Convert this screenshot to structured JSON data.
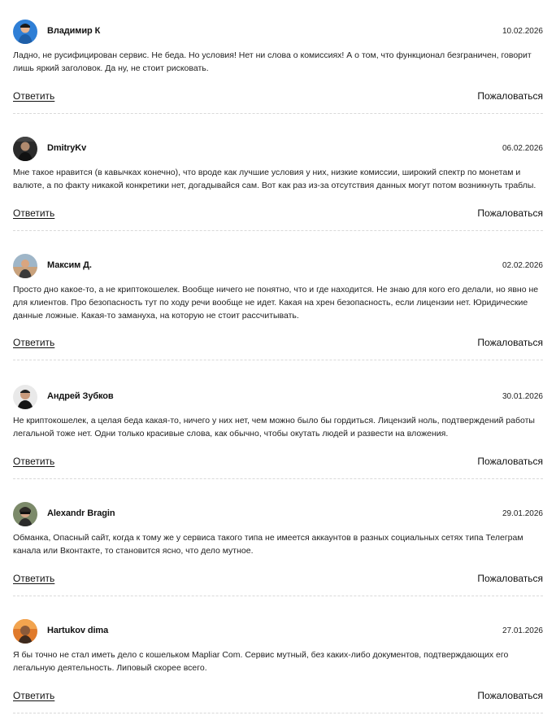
{
  "comments": [
    {
      "author": "Владимир К",
      "date": "10.02.2026",
      "text": "Ладно, не русифицирован сервис. Не беда. Но условия! Нет ни слова о комиссиях! А о том, что функционал безграничен, говорит лишь яркий заголовок. Да ну, не стоит рисковать.",
      "reply": "Ответить",
      "report": "Пожаловаться"
    },
    {
      "author": "DmitryKv",
      "date": "06.02.2026",
      "text": "Мне такое нравится (в кавычках конечно), что вроде как лучшие условия у них, низкие комиссии, широкий спектр по монетам и валюте, а по факту никакой конкретики нет, догадывайся сам. Вот как раз из-за отсутствия данных могут потом возникнуть траблы.",
      "reply": "Ответить",
      "report": "Пожаловаться"
    },
    {
      "author": "Максим Д.",
      "date": "02.02.2026",
      "text": "Просто дно какое-то, а не криптокошелек. Вообще ничего не понятно, что и где находится. Не знаю для кого его делали, но явно не для клиентов. Про безопасность тут по ходу речи вообще не идет. Какая на хрен безопасность, если лицензии нет. Юридические данные ложные. Какая-то замануха, на которую не стоит рассчитывать.",
      "reply": "Ответить",
      "report": "Пожаловаться"
    },
    {
      "author": "Андрей Зубков",
      "date": "30.01.2026",
      "text": "Не криптокошелек, а целая беда какая-то, ничего у них нет, чем можно было бы гордиться. Лицензий ноль, подтверждений работы легальной тоже нет. Одни только красивые слова, как обычно, чтобы окутать людей и развести на вложения.",
      "reply": "Ответить",
      "report": "Пожаловаться"
    },
    {
      "author": "Alexandr Bragin",
      "date": "29.01.2026",
      "text": "Обманка, Опасный сайт, когда к тому же у сервиса такого типа не имеется аккаунтов в разных социальных сетях типа Телеграм канала или Вконтакте, то становится ясно, что дело мутное.",
      "reply": "Ответить",
      "report": "Пожаловаться"
    },
    {
      "author": "Hartukov dima",
      "date": "27.01.2026",
      "text": "Я бы точно не стал иметь дело с кошельком Mapliar Com. Сервис мутный, без каких-либо документов, подтверждающих его легальную деятельность. Липовый скорее всего.",
      "reply": "Ответить",
      "report": "Пожаловаться"
    }
  ]
}
